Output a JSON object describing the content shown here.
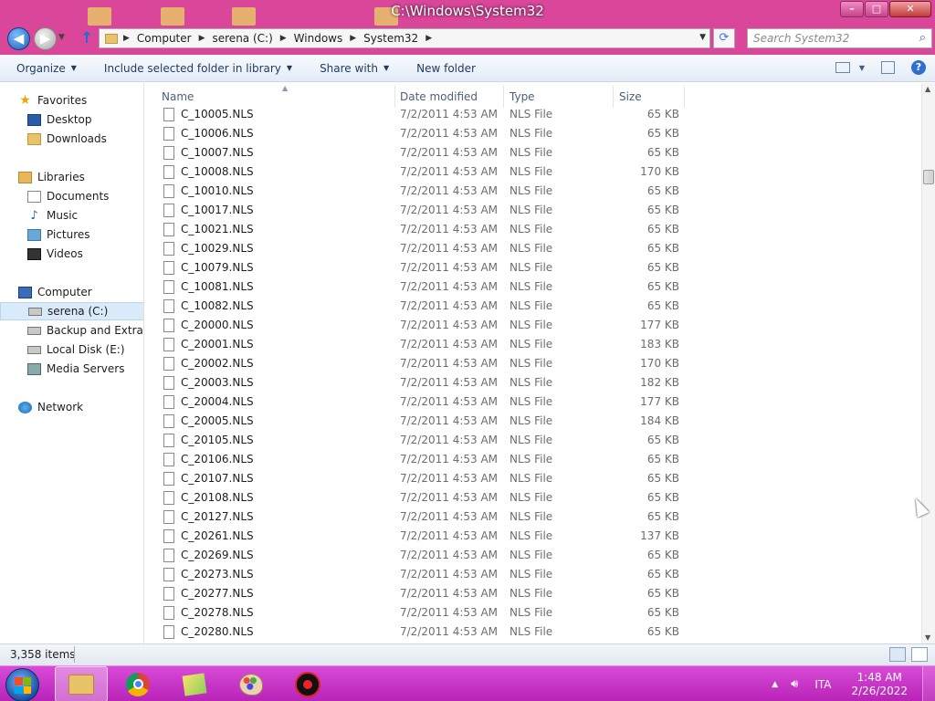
{
  "window": {
    "title": "C:\\Windows\\System32",
    "controls": {
      "minimize": "–",
      "maximize": "□",
      "close": "✕"
    }
  },
  "addressbar": {
    "breadcrumbs": [
      "Computer",
      "serena (C:)",
      "Windows",
      "System32"
    ],
    "search_placeholder": "Search System32"
  },
  "toolbar": {
    "organize": "Organize",
    "include_library": "Include selected folder in library",
    "share_with": "Share with",
    "new_folder": "New folder"
  },
  "navpane": {
    "favorites": {
      "label": "Favorites",
      "items": [
        "Desktop",
        "Downloads"
      ]
    },
    "libraries": {
      "label": "Libraries",
      "items": [
        "Documents",
        "Music",
        "Pictures",
        "Videos"
      ]
    },
    "computer": {
      "label": "Computer",
      "items": [
        "serena (C:)",
        "Backup and Extra Storage",
        "Local Disk (E:)",
        "Media Servers"
      ]
    },
    "network": {
      "label": "Network"
    }
  },
  "columns": {
    "name": "Name",
    "date_modified": "Date modified",
    "type": "Type",
    "size": "Size"
  },
  "files": [
    {
      "name": "C_10005.NLS",
      "date": "7/2/2011 4:53 AM",
      "type": "NLS File",
      "size": "65 KB"
    },
    {
      "name": "C_10006.NLS",
      "date": "7/2/2011 4:53 AM",
      "type": "NLS File",
      "size": "65 KB"
    },
    {
      "name": "C_10007.NLS",
      "date": "7/2/2011 4:53 AM",
      "type": "NLS File",
      "size": "65 KB"
    },
    {
      "name": "C_10008.NLS",
      "date": "7/2/2011 4:53 AM",
      "type": "NLS File",
      "size": "170 KB"
    },
    {
      "name": "C_10010.NLS",
      "date": "7/2/2011 4:53 AM",
      "type": "NLS File",
      "size": "65 KB"
    },
    {
      "name": "C_10017.NLS",
      "date": "7/2/2011 4:53 AM",
      "type": "NLS File",
      "size": "65 KB"
    },
    {
      "name": "C_10021.NLS",
      "date": "7/2/2011 4:53 AM",
      "type": "NLS File",
      "size": "65 KB"
    },
    {
      "name": "C_10029.NLS",
      "date": "7/2/2011 4:53 AM",
      "type": "NLS File",
      "size": "65 KB"
    },
    {
      "name": "C_10079.NLS",
      "date": "7/2/2011 4:53 AM",
      "type": "NLS File",
      "size": "65 KB"
    },
    {
      "name": "C_10081.NLS",
      "date": "7/2/2011 4:53 AM",
      "type": "NLS File",
      "size": "65 KB"
    },
    {
      "name": "C_10082.NLS",
      "date": "7/2/2011 4:53 AM",
      "type": "NLS File",
      "size": "65 KB"
    },
    {
      "name": "C_20000.NLS",
      "date": "7/2/2011 4:53 AM",
      "type": "NLS File",
      "size": "177 KB"
    },
    {
      "name": "C_20001.NLS",
      "date": "7/2/2011 4:53 AM",
      "type": "NLS File",
      "size": "183 KB"
    },
    {
      "name": "C_20002.NLS",
      "date": "7/2/2011 4:53 AM",
      "type": "NLS File",
      "size": "170 KB"
    },
    {
      "name": "C_20003.NLS",
      "date": "7/2/2011 4:53 AM",
      "type": "NLS File",
      "size": "182 KB"
    },
    {
      "name": "C_20004.NLS",
      "date": "7/2/2011 4:53 AM",
      "type": "NLS File",
      "size": "177 KB"
    },
    {
      "name": "C_20005.NLS",
      "date": "7/2/2011 4:53 AM",
      "type": "NLS File",
      "size": "184 KB"
    },
    {
      "name": "C_20105.NLS",
      "date": "7/2/2011 4:53 AM",
      "type": "NLS File",
      "size": "65 KB"
    },
    {
      "name": "C_20106.NLS",
      "date": "7/2/2011 4:53 AM",
      "type": "NLS File",
      "size": "65 KB"
    },
    {
      "name": "C_20107.NLS",
      "date": "7/2/2011 4:53 AM",
      "type": "NLS File",
      "size": "65 KB"
    },
    {
      "name": "C_20108.NLS",
      "date": "7/2/2011 4:53 AM",
      "type": "NLS File",
      "size": "65 KB"
    },
    {
      "name": "C_20127.NLS",
      "date": "7/2/2011 4:53 AM",
      "type": "NLS File",
      "size": "65 KB"
    },
    {
      "name": "C_20261.NLS",
      "date": "7/2/2011 4:53 AM",
      "type": "NLS File",
      "size": "137 KB"
    },
    {
      "name": "C_20269.NLS",
      "date": "7/2/2011 4:53 AM",
      "type": "NLS File",
      "size": "65 KB"
    },
    {
      "name": "C_20273.NLS",
      "date": "7/2/2011 4:53 AM",
      "type": "NLS File",
      "size": "65 KB"
    },
    {
      "name": "C_20277.NLS",
      "date": "7/2/2011 4:53 AM",
      "type": "NLS File",
      "size": "65 KB"
    },
    {
      "name": "C_20278.NLS",
      "date": "7/2/2011 4:53 AM",
      "type": "NLS File",
      "size": "65 KB"
    },
    {
      "name": "C_20280.NLS",
      "date": "7/2/2011 4:53 AM",
      "type": "NLS File",
      "size": "65 KB"
    }
  ],
  "statusbar": {
    "item_count": "3,358 items"
  },
  "taskbar": {
    "apps": [
      "windows-explorer",
      "google-chrome",
      "sticky-notes",
      "paint",
      "screen-recorder"
    ],
    "tray": {
      "language": "ITA",
      "time": "1:48 AM",
      "date": "2/26/2022"
    }
  },
  "colors": {
    "window_frame": "#d9469a",
    "taskbar": "#c52ec5",
    "selection": "#d9ebfa",
    "link_blue": "#1e3a5f"
  }
}
